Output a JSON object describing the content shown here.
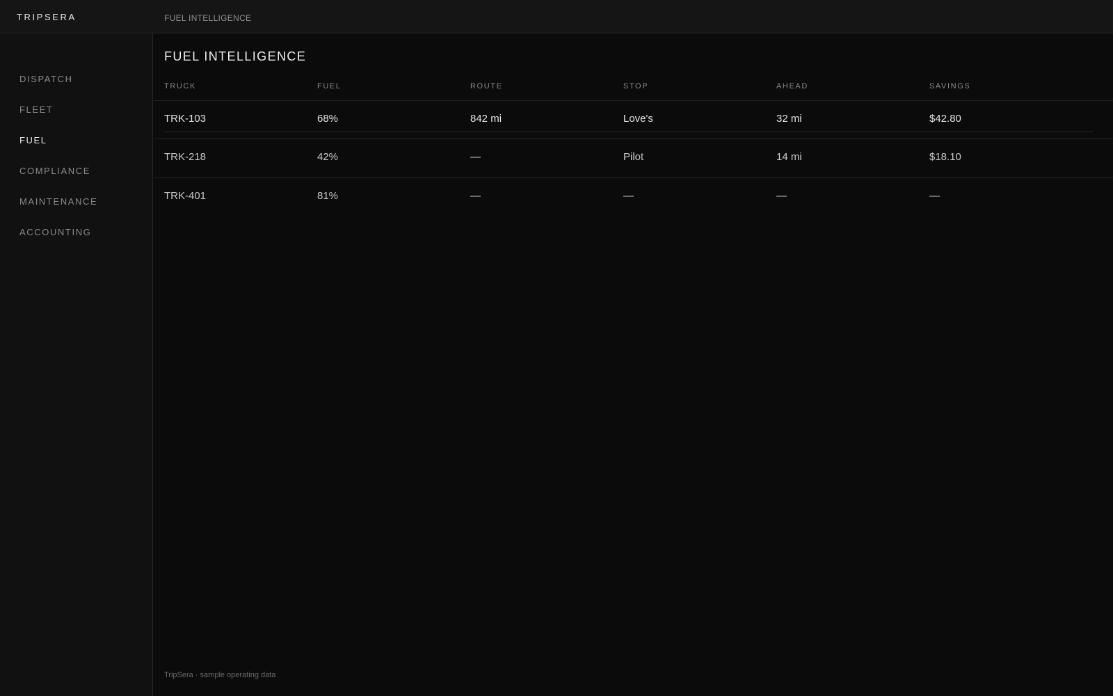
{
  "app": {
    "brand": "TRIPSERA",
    "header_title": "FUEL INTELLIGENCE"
  },
  "sidebar": {
    "items": [
      {
        "label": "DISPATCH",
        "active": false
      },
      {
        "label": "FLEET",
        "active": false
      },
      {
        "label": "FUEL",
        "active": true
      },
      {
        "label": "COMPLIANCE",
        "active": false
      },
      {
        "label": "MAINTENANCE",
        "active": false
      },
      {
        "label": "ACCOUNTING",
        "active": false
      }
    ]
  },
  "main": {
    "title": "FUEL INTELLIGENCE",
    "table": {
      "columns": [
        "TRUCK",
        "FUEL",
        "ROUTE",
        "STOP",
        "AHEAD",
        "SAVINGS"
      ],
      "rows": [
        [
          "TRK-103",
          "68%",
          "842 mi",
          "Love's",
          "32 mi",
          "$42.80"
        ],
        [
          "TRK-218",
          "42%",
          "—",
          "Pilot",
          "14 mi",
          "$18.10"
        ],
        [
          "TRK-401",
          "81%",
          "—",
          "—",
          "—",
          "—"
        ]
      ]
    }
  },
  "footer": {
    "text": "TripSera · sample operating data"
  },
  "colors": {
    "background": "#0b0b0b",
    "sidebar": "#111111",
    "topbar": "#151515",
    "text": "#e8e8e8",
    "muted": "#8a8a8a"
  }
}
